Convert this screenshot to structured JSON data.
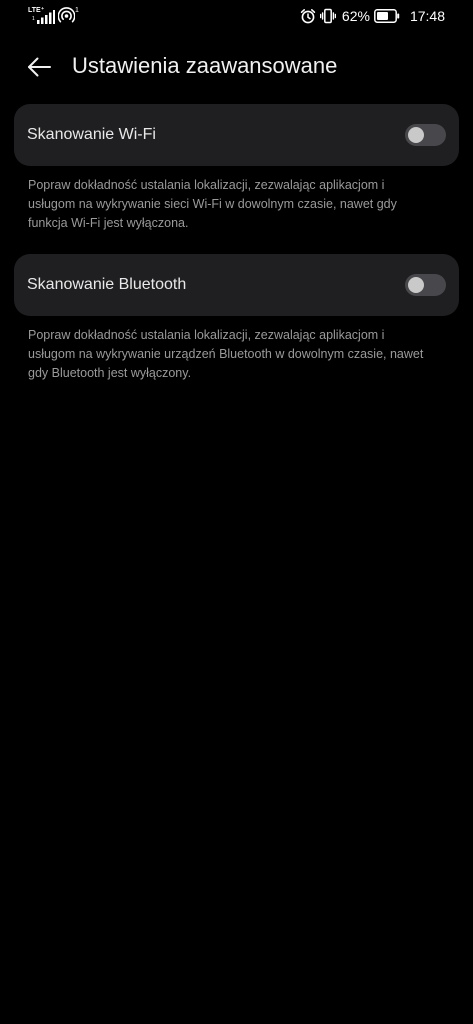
{
  "status_bar": {
    "network_type": "LTE⁺",
    "sim_slot": "1",
    "hotspot_count": "1",
    "battery_percent": "62%",
    "time": "17:48",
    "icons": [
      "signal-icon",
      "hotspot-icon",
      "alarm-icon",
      "vibrate-icon",
      "battery-icon"
    ]
  },
  "header": {
    "back_icon": "arrow-left-icon",
    "title": "Ustawienia zaawansowane"
  },
  "wifi_scanning": {
    "label": "Skanowanie Wi-Fi",
    "enabled": false,
    "description_lines": [
      "Popraw dokładność ustalania lokalizacji, zezwalając aplikacjom i",
      "usługom na wykrywanie sieci Wi-Fi w dowolnym czasie, nawet gdy",
      "funkcja Wi-Fi jest wyłączona."
    ]
  },
  "bluetooth_scanning": {
    "label": "Skanowanie Bluetooth",
    "enabled": false,
    "description_lines": [
      "Popraw dokładność ustalania lokalizacji, zezwalając aplikacjom i",
      "usługom na wykrywanie urządzeń Bluetooth w dowolnym czasie, nawet",
      "gdy Bluetooth jest wyłączony."
    ]
  },
  "colors": {
    "background": "#000000",
    "card": "#1f1f21",
    "toggle_off_track": "#48484c",
    "toggle_off_knob": "#c9c9c9",
    "secondary_text": "#9a9a9a"
  }
}
